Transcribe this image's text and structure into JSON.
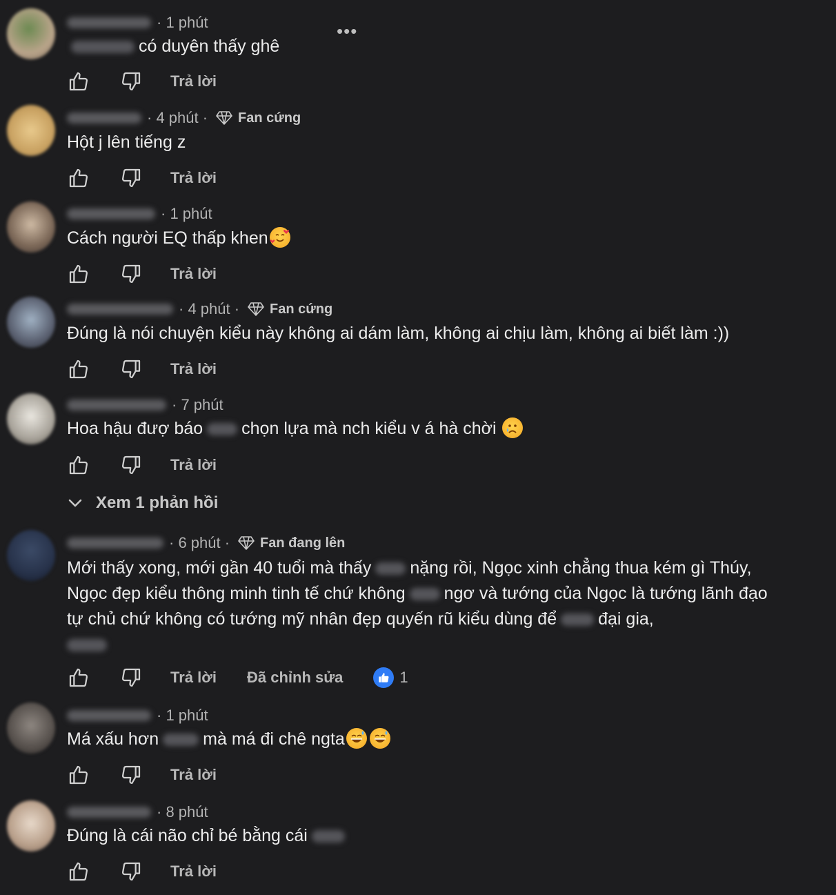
{
  "colors": {
    "background": "#1d1d1f",
    "text": "#ececec",
    "muted": "#b3b3b3",
    "reaction_blue": "#2f7cf6"
  },
  "reply_label": "Trả lời",
  "more_icon": "more-horizontal-icon",
  "comments": [
    {
      "time": "· 1 phút",
      "badge": "",
      "text_before": "có duyên thấy ghê",
      "text_after": "",
      "emoji": "",
      "edited": "",
      "reactions": ""
    },
    {
      "time": "· 4 phút ·",
      "badge": "Fan cứng",
      "text_before": "Hột j lên tiếng z",
      "text_after": "",
      "emoji": "",
      "edited": "",
      "reactions": ""
    },
    {
      "time": "· 1 phút",
      "badge": "",
      "text_before": "Cách người EQ thấp khen",
      "text_after": "",
      "emoji": "smiling-face-with-hearts",
      "edited": "",
      "reactions": ""
    },
    {
      "time": "· 4 phút ·",
      "badge": "Fan cứng",
      "text_before": "Đúng là nói chuyện kiểu này không ai dám làm, không ai chịu làm, không ai biết làm :))",
      "text_after": "",
      "emoji": "",
      "edited": "",
      "reactions": ""
    },
    {
      "time": "· 7 phút",
      "badge": "",
      "text_before": "Hoa hậu đượ báo",
      "text_after": "chọn lựa mà nch kiểu v á hà chời",
      "emoji": "crying-face",
      "edited": "",
      "reactions": ""
    },
    {
      "time": "· 6 phút ·",
      "badge": "Fan đang lên",
      "text_l1_a": "Mới thấy xong, mới gần 40 tuổi mà thấy",
      "text_l1_b": "nặng rồi, Ngọc xinh chẳng thua kém gì Thúy,",
      "text_l2_a": "Ngọc đẹp kiểu thông minh tinh tế chứ không",
      "text_l2_b": "ngơ và tướng của Ngọc là tướng lãnh đạo",
      "text_l3_a": "tự chủ chứ không có tướng mỹ nhân đẹp quyến rũ kiểu dùng để",
      "text_l3_b": "đại gia,",
      "edited": "Đã chỉnh sửa",
      "reactions": "1"
    },
    {
      "time": "· 1 phút",
      "badge": "",
      "text_before": "Má xấu hơn",
      "text_after": "mà má đi chê ngta",
      "emoji": "grinning-sweat",
      "edited": "",
      "reactions": ""
    },
    {
      "time": "· 8 phút",
      "badge": "",
      "text_before": "Đúng là cái não chỉ bé bằng cái",
      "text_after": "",
      "emoji": "",
      "edited": "",
      "reactions": ""
    }
  ],
  "view_replies": "Xem 1 phản hồi"
}
